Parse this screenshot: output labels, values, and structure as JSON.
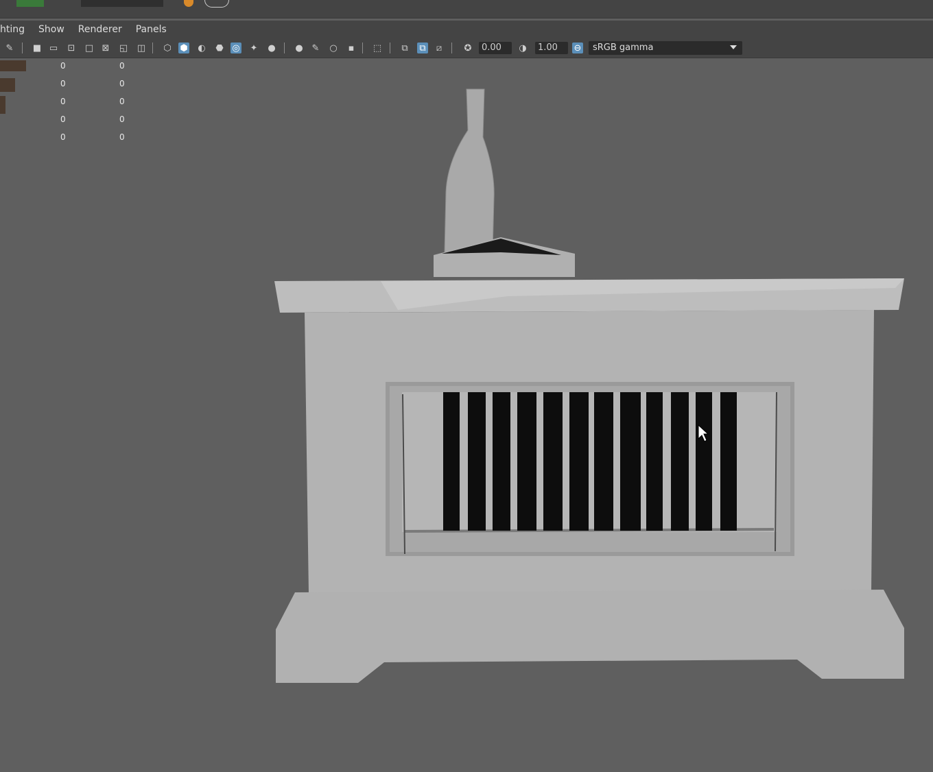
{
  "menubar": {
    "items": [
      "hting",
      "Show",
      "Renderer",
      "Panels"
    ]
  },
  "toolbar": {
    "exposure_value": "0.00",
    "gamma_value": "1.00",
    "colorspace": "sRGB gamma"
  },
  "hud": {
    "rows": [
      {
        "col1": "0",
        "col2": "0"
      },
      {
        "col1": "0",
        "col2": "0"
      },
      {
        "col1": "0",
        "col2": "0"
      },
      {
        "col1": "0",
        "col2": "0"
      },
      {
        "col1": "0",
        "col2": "0"
      }
    ]
  },
  "colors": {
    "background": "#5f5f5f",
    "panel": "#444444",
    "active_icon": "#5b8fb9",
    "model_light": "#b8b8b8",
    "grille_dark": "#0d0d0d"
  },
  "icons": [
    "pencil-icon",
    "select-icon",
    "film-gate-icon",
    "camera-icon",
    "wireframe-icon",
    "smooth-shade-icon",
    "shadow-icon",
    "xray-icon",
    "light-icon",
    "exposure-icon",
    "gamma-icon",
    "colorspace-icon",
    "mouse-cursor-icon"
  ]
}
